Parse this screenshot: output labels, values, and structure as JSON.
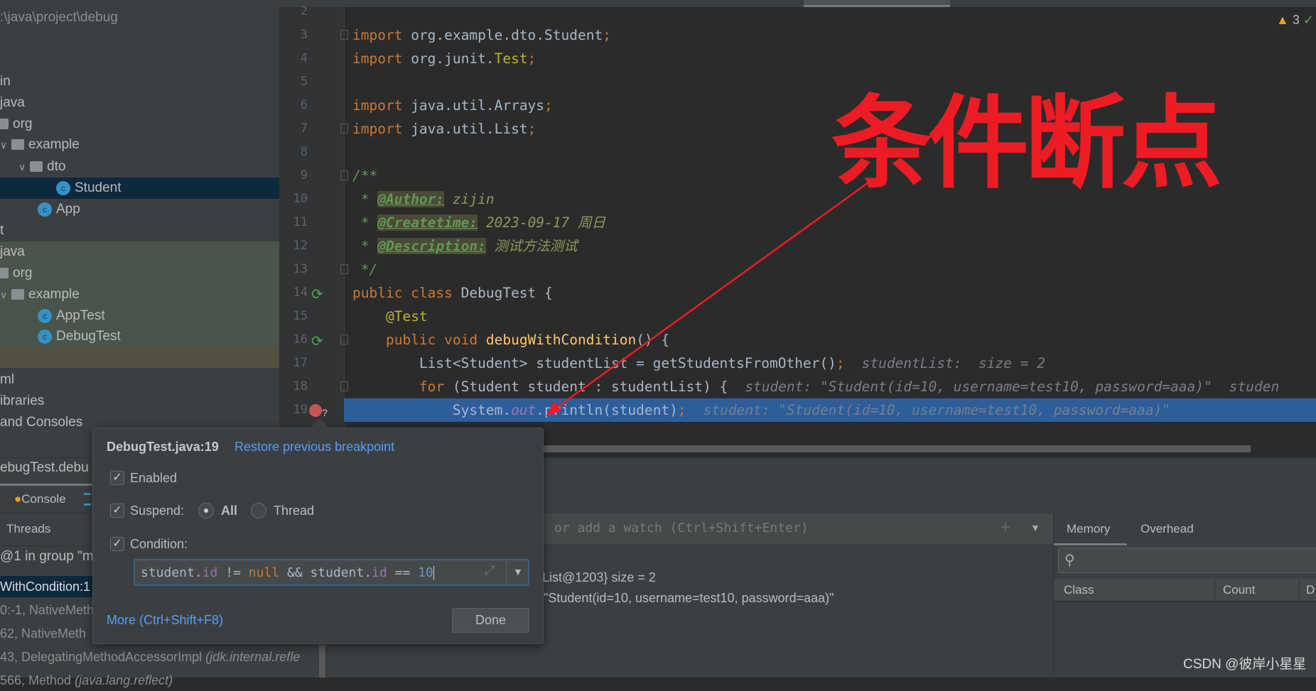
{
  "project_tree": {
    "path": ":\\java\\project\\debug",
    "items": [
      {
        "label": "in"
      },
      {
        "label": "java"
      },
      {
        "label": "org"
      },
      {
        "label": "example"
      },
      {
        "label": "dto"
      },
      {
        "label": "Student",
        "selected": true
      },
      {
        "label": "App"
      },
      {
        "label": "t"
      },
      {
        "label": "java"
      },
      {
        "label": "org"
      },
      {
        "label": "example"
      },
      {
        "label": "AppTest"
      },
      {
        "label": "DebugTest"
      },
      {
        "label": ""
      },
      {
        "label": "ml"
      },
      {
        "label": "ibraries"
      },
      {
        "label": " and Consoles"
      }
    ],
    "class_icon_letter": "c"
  },
  "editor": {
    "warnings": "3",
    "warning_icon": "warning-triangle-icon",
    "lines": [
      {
        "n": "2",
        "t": []
      },
      {
        "n": "3",
        "t": [
          [
            "import",
            "kw"
          ],
          [
            " org.example.dto.Student",
            ""
          ],
          [
            ";",
            "kw"
          ]
        ]
      },
      {
        "n": "4",
        "t": [
          [
            "import",
            "kw"
          ],
          [
            " org.junit.",
            ""
          ],
          [
            "Test",
            "ann"
          ],
          [
            ";",
            "kw"
          ]
        ]
      },
      {
        "n": "5",
        "t": []
      },
      {
        "n": "6",
        "t": [
          [
            "import",
            "kw"
          ],
          [
            " java.util.Arrays",
            ""
          ],
          [
            ";",
            "kw"
          ]
        ]
      },
      {
        "n": "7",
        "t": [
          [
            "import",
            "kw"
          ],
          [
            " java.util.List",
            ""
          ],
          [
            ";",
            "kw"
          ]
        ]
      },
      {
        "n": "8",
        "t": []
      },
      {
        "n": "9",
        "t": [
          [
            "/**",
            "cm"
          ]
        ]
      },
      {
        "n": "10",
        "t": [
          [
            " * ",
            "cm"
          ],
          [
            "@Author:",
            "tag"
          ],
          [
            " ",
            "cm"
          ],
          [
            "zijin",
            "val"
          ]
        ]
      },
      {
        "n": "11",
        "t": [
          [
            " * ",
            "cm"
          ],
          [
            "@Createtime:",
            "tag"
          ],
          [
            " 2023-09-17 周日",
            "val"
          ]
        ]
      },
      {
        "n": "12",
        "t": [
          [
            " * ",
            "cm"
          ],
          [
            "@Description:",
            "tag"
          ],
          [
            " 测试方法测试",
            "val"
          ]
        ]
      },
      {
        "n": "13",
        "t": [
          [
            " */",
            "cm"
          ]
        ]
      },
      {
        "n": "14",
        "t": [
          [
            "public class ",
            "kw"
          ],
          [
            "DebugTest {",
            ""
          ]
        ]
      },
      {
        "n": "15",
        "t": [
          [
            "    ",
            ""
          ],
          [
            "@Test",
            "ann"
          ]
        ]
      },
      {
        "n": "16",
        "t": [
          [
            "    ",
            ""
          ],
          [
            "public void ",
            "kw"
          ],
          [
            "debugWithCondition",
            "fn"
          ],
          [
            "() {",
            ""
          ]
        ]
      },
      {
        "n": "17",
        "t": [
          [
            "        List<Student> studentList = getStudentsFromOther()",
            ""
          ],
          [
            ";",
            "kw"
          ],
          [
            "studentList:  size = 2",
            "hint"
          ]
        ]
      },
      {
        "n": "18",
        "t": [
          [
            "        ",
            ""
          ],
          [
            "for ",
            "kw"
          ],
          [
            "(Student student : studentList) {",
            ""
          ],
          [
            "student: \"Student(id=10, username=test10, password=aaa)\"",
            "hint"
          ],
          [
            "studen",
            "hint"
          ]
        ]
      },
      {
        "n": "19",
        "t": [
          [
            "            System.",
            ""
          ],
          [
            "out",
            "st"
          ],
          [
            ".println(student)",
            ""
          ],
          [
            ";",
            "kw"
          ],
          [
            "student: \"Student(id=10, username=test10, password=aaa)\"",
            "hint"
          ]
        ],
        "current": true
      }
    ]
  },
  "annotation": {
    "text": "条件断点",
    "color": "#ed1c24"
  },
  "debug_panel": {
    "session_tab": "ebugTest.debu",
    "console_tab": "Console",
    "threads_label": "Threads",
    "thread_group": "@1 in group \"m",
    "frames": [
      {
        "label": "WithCondition:1",
        "selected": true
      },
      {
        "label": "0:-1, NativeMeth"
      },
      {
        "label": "62, NativeMeth"
      },
      {
        "label": "43, DelegatingMethodAccessorImpl ",
        "italic": "(jdk.internal.refle"
      },
      {
        "label": "566, Method ",
        "italic": "(java.lang.reflect)"
      }
    ],
    "watch_placeholder": "or add a watch (Ctrl+Shift+Enter)",
    "variables": [
      "List@1203}  size = 2",
      "\"Student(id=10, username=test10, password=aaa)\""
    ],
    "memory_tabs": [
      "Memory",
      "Overhead"
    ],
    "memory_columns": [
      "Class",
      "Count",
      "D"
    ]
  },
  "popup": {
    "title": "DebugTest.java:19",
    "restore_link": "Restore previous breakpoint",
    "enabled_label": "Enabled",
    "enabled": true,
    "suspend_label": "Suspend:",
    "suspend": true,
    "suspend_options": [
      "All",
      "Thread"
    ],
    "suspend_selected": "All",
    "condition_label": "Condition:",
    "condition_enabled": true,
    "condition_tokens": [
      [
        "student.",
        ""
      ],
      [
        "id",
        "st"
      ],
      [
        " != ",
        ""
      ],
      [
        "null",
        "kw"
      ],
      [
        " && student.",
        ""
      ],
      [
        "id",
        "st"
      ],
      [
        " == ",
        ""
      ],
      [
        "10",
        "num"
      ]
    ],
    "more_link": "More (Ctrl+Shift+F8)",
    "done_label": "Done"
  },
  "watermark": "CSDN @彼岸小星星",
  "colors": {
    "accent_link": "#589df6",
    "current_line": "#2d5e9c",
    "selection": "#0d293e",
    "annotation_red": "#ed1c24"
  }
}
